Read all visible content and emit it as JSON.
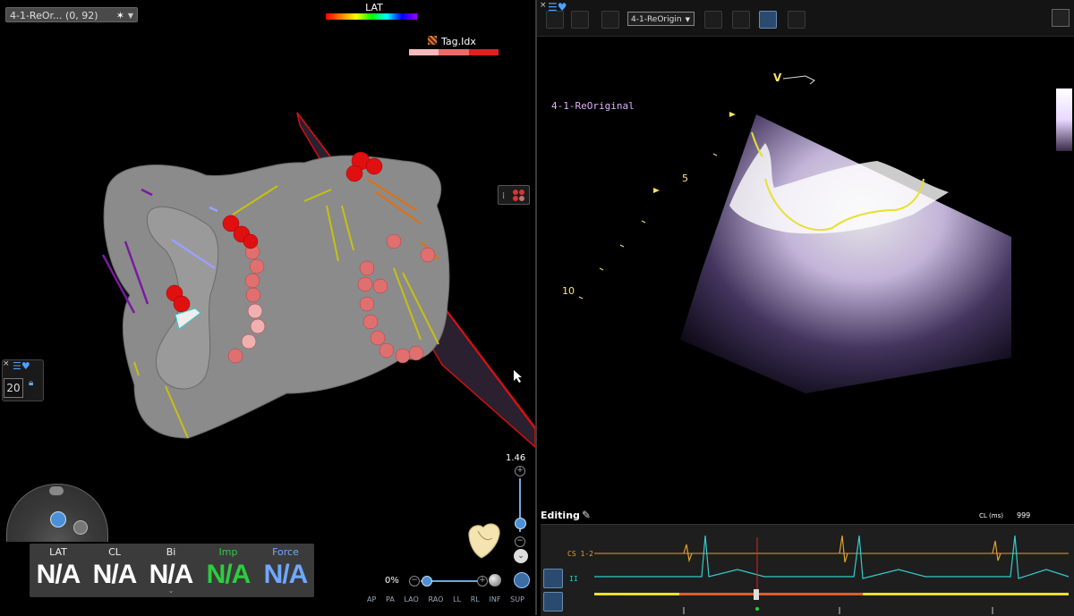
{
  "left": {
    "map_tab_label": "4-1-ReOr... (0, 92)",
    "lat_title": "LAT",
    "tag_title": "Tag.Idx",
    "tag_colors": [
      "#f6b9b9",
      "#ec6b6b",
      "#e02020"
    ],
    "side_panel_close": "×",
    "side_panel_number": "20",
    "zoom_value": "1.46",
    "opacity_value": "0%",
    "view_labels": [
      "AP",
      "PA",
      "LAO",
      "RAO",
      "LL",
      "RL",
      "INF",
      "SUP"
    ],
    "metrics": [
      {
        "label": "LAT",
        "value": "N/A",
        "color": "#ffffff"
      },
      {
        "label": "CL",
        "value": "N/A",
        "color": "#ffffff"
      },
      {
        "label": "Bi",
        "value": "N/A",
        "color": "#ffffff"
      },
      {
        "label": "Imp",
        "value": "N/A",
        "color": "#2ecc40"
      },
      {
        "label": "Force",
        "value": "N/A",
        "color": "#6fa8ff"
      }
    ]
  },
  "right": {
    "toolbar_close": "×",
    "dataset_select": "4-1-ReOrigin",
    "ultrasound_label": "4-1-ReOriginal",
    "depth_marker_5": "5",
    "depth_marker_10": "10",
    "v_marker": "V",
    "editing_label": "Editing",
    "cl_label": "CL (ms)",
    "cl_value": "999",
    "ecg_channels": [
      {
        "label": "CS 1-2",
        "color": "#e0a030"
      },
      {
        "label": "II",
        "color": "#33cccc"
      }
    ]
  }
}
